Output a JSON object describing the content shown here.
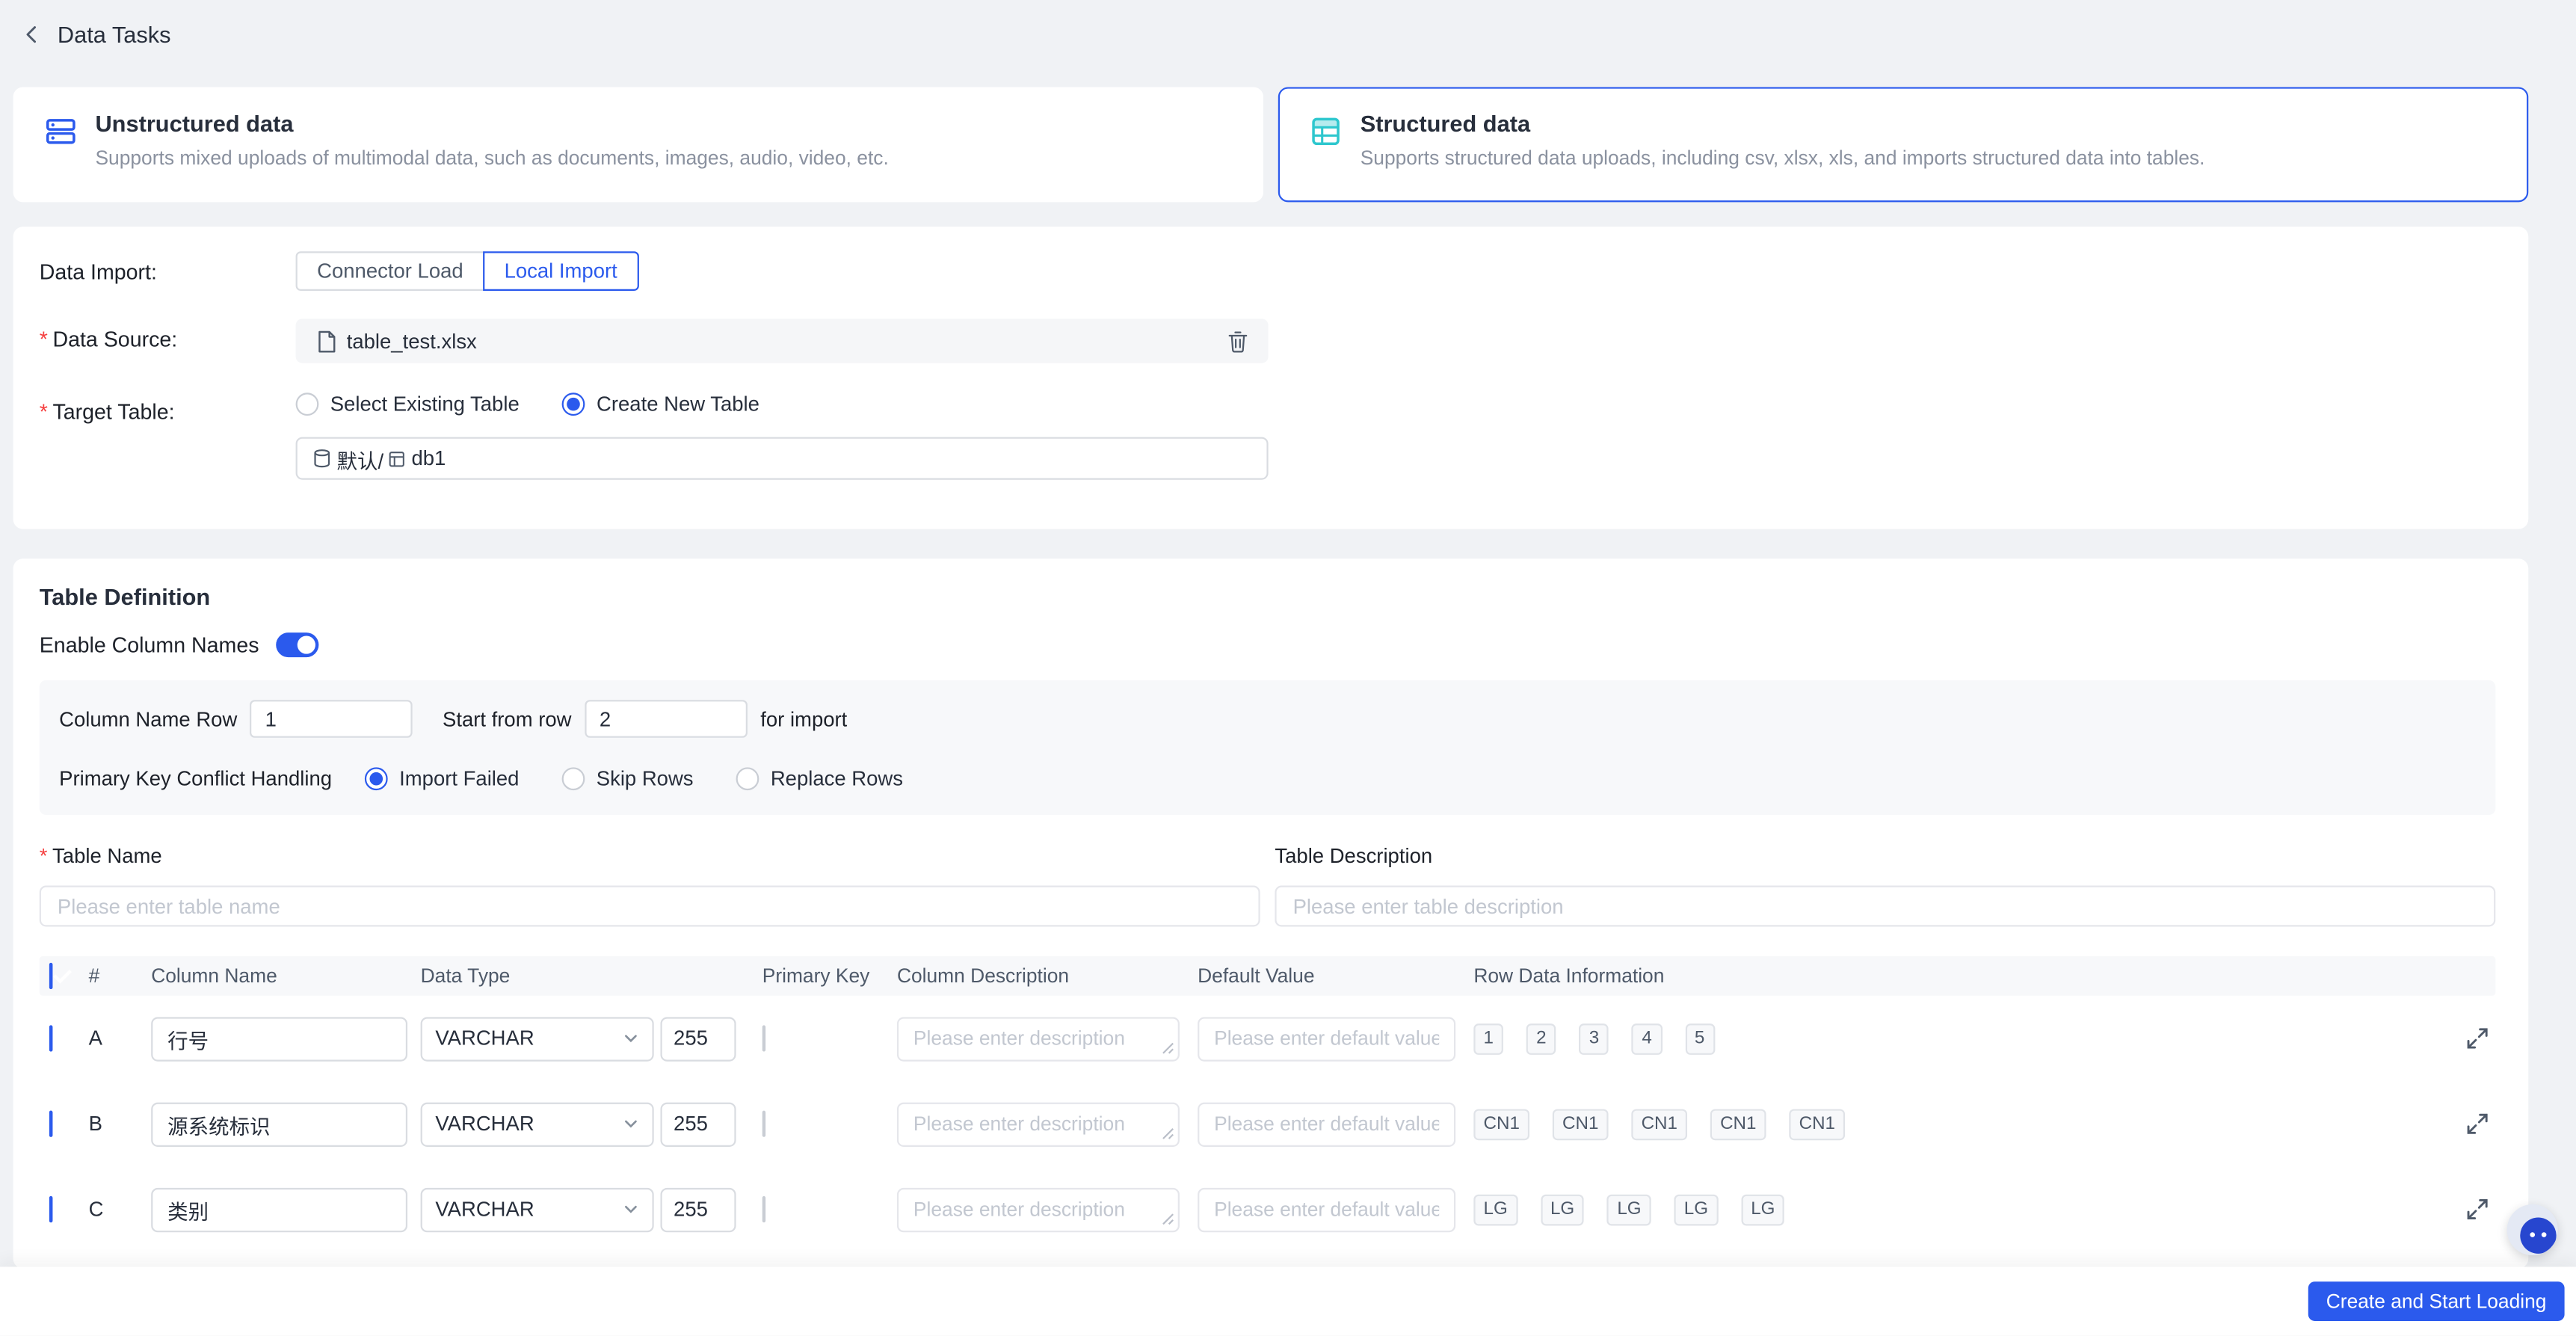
{
  "page": {
    "title": "Data Tasks",
    "required_mark": "*"
  },
  "data_type_cards": {
    "unstructured": {
      "title": "Unstructured data",
      "description": "Supports mixed uploads of multimodal data, such as documents, images, audio, video, etc.",
      "selected": false,
      "icon": "server-icon"
    },
    "structured": {
      "title": "Structured data",
      "description": "Supports structured data uploads, including csv, xlsx, xls, and imports structured data into tables.",
      "selected": true,
      "icon": "table-icon"
    }
  },
  "import_form": {
    "data_import_label": "Data Import:",
    "tabs": {
      "connector": {
        "label": "Connector Load",
        "selected": false
      },
      "local": {
        "label": "Local Import",
        "selected": true
      }
    },
    "data_source_label": "Data Source:",
    "data_source_file": "table_test.xlsx",
    "target_table_label": "Target Table:",
    "target_options": {
      "existing": {
        "label": "Select Existing Table",
        "selected": false
      },
      "create": {
        "label": "Create New Table",
        "selected": true
      }
    },
    "target_path": {
      "catalog": "默认/",
      "database": "db1"
    }
  },
  "table_definition": {
    "title": "Table Definition",
    "enable_column_names": {
      "label": "Enable Column Names",
      "on": true
    },
    "header_row": {
      "column_name_row_label": "Column Name Row",
      "column_name_row_value": "1",
      "start_from_row_label": "Start from row",
      "start_from_row_value": "2",
      "suffix_label": "for import"
    },
    "conflict": {
      "label": "Primary Key Conflict Handling",
      "options": {
        "import_failed": {
          "label": "Import Failed",
          "selected": true
        },
        "skip_rows": {
          "label": "Skip Rows",
          "selected": false
        },
        "replace_rows": {
          "label": "Replace Rows",
          "selected": false
        }
      }
    },
    "table_name": {
      "label": "Table Name",
      "placeholder": "Please enter table name",
      "value": ""
    },
    "table_description": {
      "label": "Table Description",
      "placeholder": "Please enter table description",
      "value": ""
    }
  },
  "columns_table": {
    "select_all_checked": true,
    "headers": {
      "index": "#",
      "column_name": "Column Name",
      "data_type": "Data Type",
      "primary_key": "Primary Key",
      "column_description": "Column Description",
      "default_value": "Default Value",
      "row_data_information": "Row Data Information"
    },
    "description_placeholder": "Please enter description",
    "default_value_placeholder": "Please enter default value",
    "rows": [
      {
        "id": "A",
        "checked": true,
        "column_name": "行号",
        "data_type": "VARCHAR",
        "length": "255",
        "primary_key": false,
        "row_data": [
          "1",
          "2",
          "3",
          "4",
          "5"
        ]
      },
      {
        "id": "B",
        "checked": true,
        "column_name": "源系统标识",
        "data_type": "VARCHAR",
        "length": "255",
        "primary_key": false,
        "row_data": [
          "CN1",
          "CN1",
          "CN1",
          "CN1",
          "CN1"
        ]
      },
      {
        "id": "C",
        "checked": true,
        "column_name": "类别",
        "data_type": "VARCHAR",
        "length": "255",
        "primary_key": false,
        "row_data": [
          "LG",
          "LG",
          "LG",
          "LG",
          "LG"
        ]
      }
    ]
  },
  "footer": {
    "submit_label": "Create and Start Loading"
  },
  "colors": {
    "primary": "#2b5aed",
    "structured_icon_teal": "#2ec7ce",
    "required_red": "#f53f3f"
  }
}
